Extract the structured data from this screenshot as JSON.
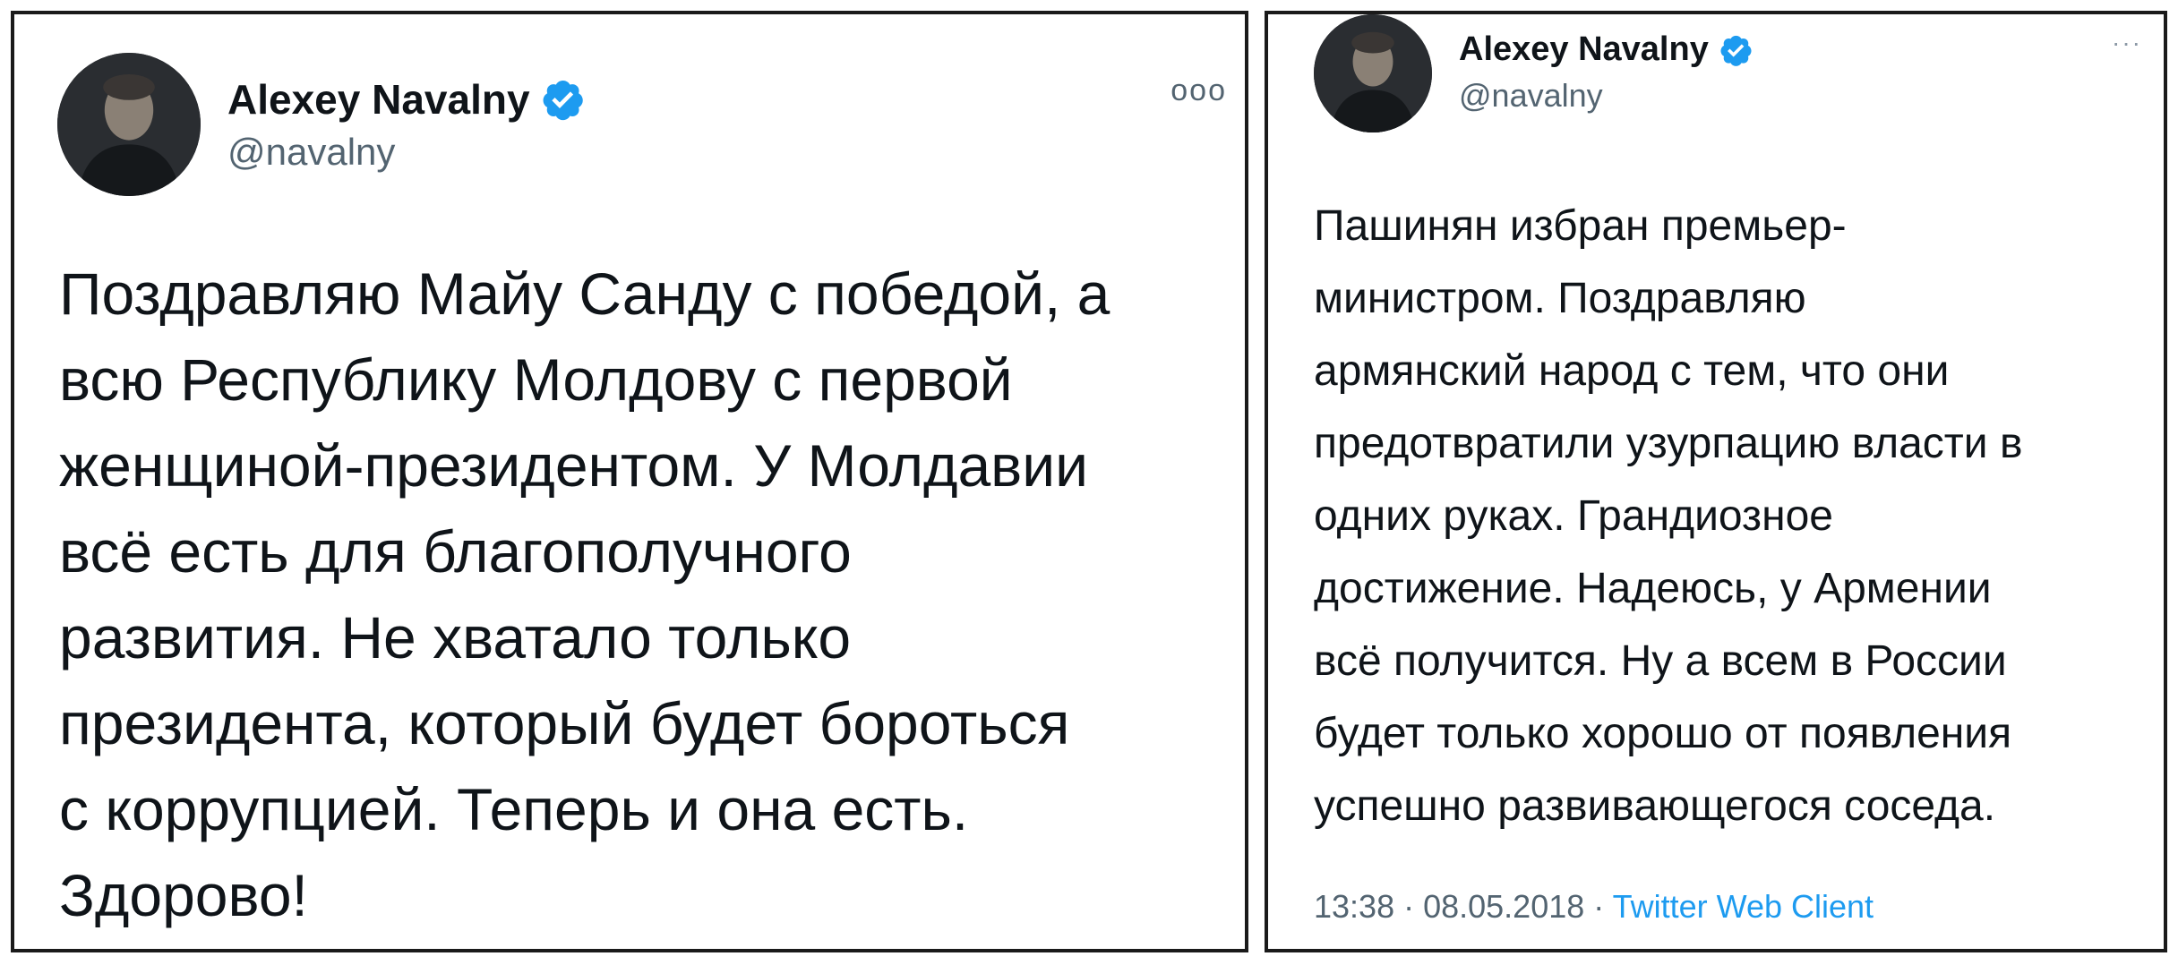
{
  "tweets": [
    {
      "author_name": "Alexey Navalny",
      "handle": "@navalny",
      "more_label": "ooo",
      "text": "Поздравляю Майу Санду с победой, а\nвсю Республику Молдову с первой\nженщиной-президентом. У Молдавии\nвсё есть для благополучного\nразвития. Не хватало только\nпрезидента, который будет бороться\nс коррупцией. Теперь и она есть.\nЗдорово!"
    },
    {
      "author_name": "Alexey Navalny",
      "handle": "@navalny",
      "more_label": "···",
      "text": "Пашинян избран премьер-\nминистром. Поздравляю\nармянский народ с тем, что они\nпредотвратили узурпацию власти в\nодних руках. Грандиозное\nдостижение. Надеюсь, у Армении\nвсё получится. Ну а всем в России\nбудет только хорошо от появления\nуспешно развивающегося соседа.",
      "time": "13:38",
      "date": "08.05.2018",
      "source": "Twitter Web Client",
      "separator": " · "
    }
  ],
  "colors": {
    "verified": "#1d9bf0",
    "handle": "#536471",
    "link": "#1d9bf0"
  },
  "icons": {
    "verified": "verified-badge-icon",
    "more": "more-options-icon"
  }
}
